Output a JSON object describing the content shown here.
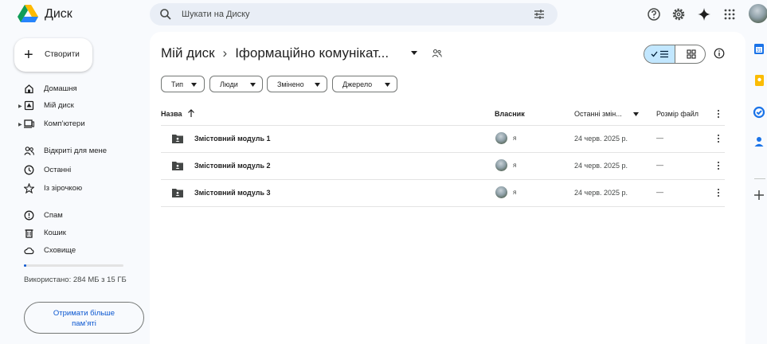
{
  "header": {
    "app_name": "Диск",
    "search_placeholder": "Шукати на Диску",
    "icons": [
      "help-icon",
      "settings-icon",
      "gemini-icon",
      "apps-grid-icon"
    ]
  },
  "sidebar": {
    "create_label": "Створити",
    "nav_primary": [
      {
        "label": "Домашня",
        "icon": "home-icon"
      },
      {
        "label": "Мій диск",
        "icon": "my-drive-icon"
      },
      {
        "label": "Комп’ютери",
        "icon": "computer-icon"
      }
    ],
    "nav_shared": [
      {
        "label": "Відкриті для мене",
        "icon": "shared-icon"
      },
      {
        "label": "Останні",
        "icon": "clock-icon"
      },
      {
        "label": "Із зірочкою",
        "icon": "star-icon"
      }
    ],
    "nav_other": [
      {
        "label": "Спам",
        "icon": "spam-icon"
      },
      {
        "label": "Кошик",
        "icon": "trash-icon"
      },
      {
        "label": "Сховище",
        "icon": "cloud-icon"
      }
    ],
    "storage_fraction": 0.019,
    "storage_text": "Використано: 284 МБ з 15 ГБ",
    "get_more_label": "Отримати більше пам’яті"
  },
  "main": {
    "breadcrumb_root": "Мій диск",
    "breadcrumb_separator": "›",
    "breadcrumb_current": "Іформаційно комунікат...",
    "filters": [
      "Тип",
      "Люди",
      "Змінено",
      "Джерело"
    ],
    "columns": {
      "name": "Назва",
      "owner": "Власник",
      "modified": "Останні змін...",
      "size": "Розмір файл"
    },
    "rows": [
      {
        "name": "Змістовний модуль 1",
        "owner": "я",
        "modified": "24 черв. 2025 р.",
        "size": "—"
      },
      {
        "name": "Змістовний модуль 2",
        "owner": "я",
        "modified": "24 черв. 2025 р.",
        "size": "—"
      },
      {
        "name": "Змістовний модуль 3",
        "owner": "я",
        "modified": "24 черв. 2025 р.",
        "size": "—"
      }
    ]
  },
  "colors": {
    "accent": "#0b57d0",
    "toggle_selected": "#c2e7ff",
    "background": "#f8fafd",
    "search_bg": "#e9eef6"
  }
}
